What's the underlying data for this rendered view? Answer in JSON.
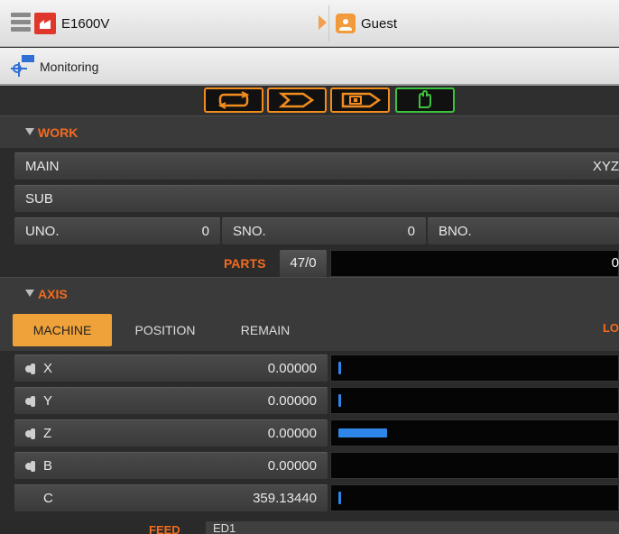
{
  "header": {
    "machine_name": "E1600V",
    "user_name": "Guest"
  },
  "subheader": {
    "title": "Monitoring"
  },
  "sections": {
    "work": "WORK",
    "axis": "AXIS"
  },
  "work": {
    "main_label": "MAIN",
    "main_value": "XYZ",
    "sub_label": "SUB",
    "uno_label": "UNO.",
    "uno_value": "0",
    "sno_label": "SNO.",
    "sno_value": "0",
    "bno_label": "BNO.",
    "parts_label": "PARTS",
    "parts_value": "47/0",
    "parts_right": "0"
  },
  "axis_tabs": [
    "MACHINE",
    "POSITION",
    "REMAIN"
  ],
  "axis_right_label": "LO",
  "axes": [
    {
      "name": "X",
      "value": "0.00000",
      "level": 0.01
    },
    {
      "name": "Y",
      "value": "0.00000",
      "level": 0.01
    },
    {
      "name": "Z",
      "value": "0.00000",
      "level": 0.17
    },
    {
      "name": "B",
      "value": "0.00000",
      "level": 0
    },
    {
      "name": "C",
      "value": "359.13440",
      "level": 0.005
    }
  ],
  "footer": {
    "feed_label": "FEED",
    "feed_value": "ED1"
  },
  "colors": {
    "accent": "#f36b1f",
    "tab_active": "#f0a23a",
    "bar": "#2e86e8",
    "mode_border": "#f28c1e",
    "mode_active": "#3cc23c"
  }
}
